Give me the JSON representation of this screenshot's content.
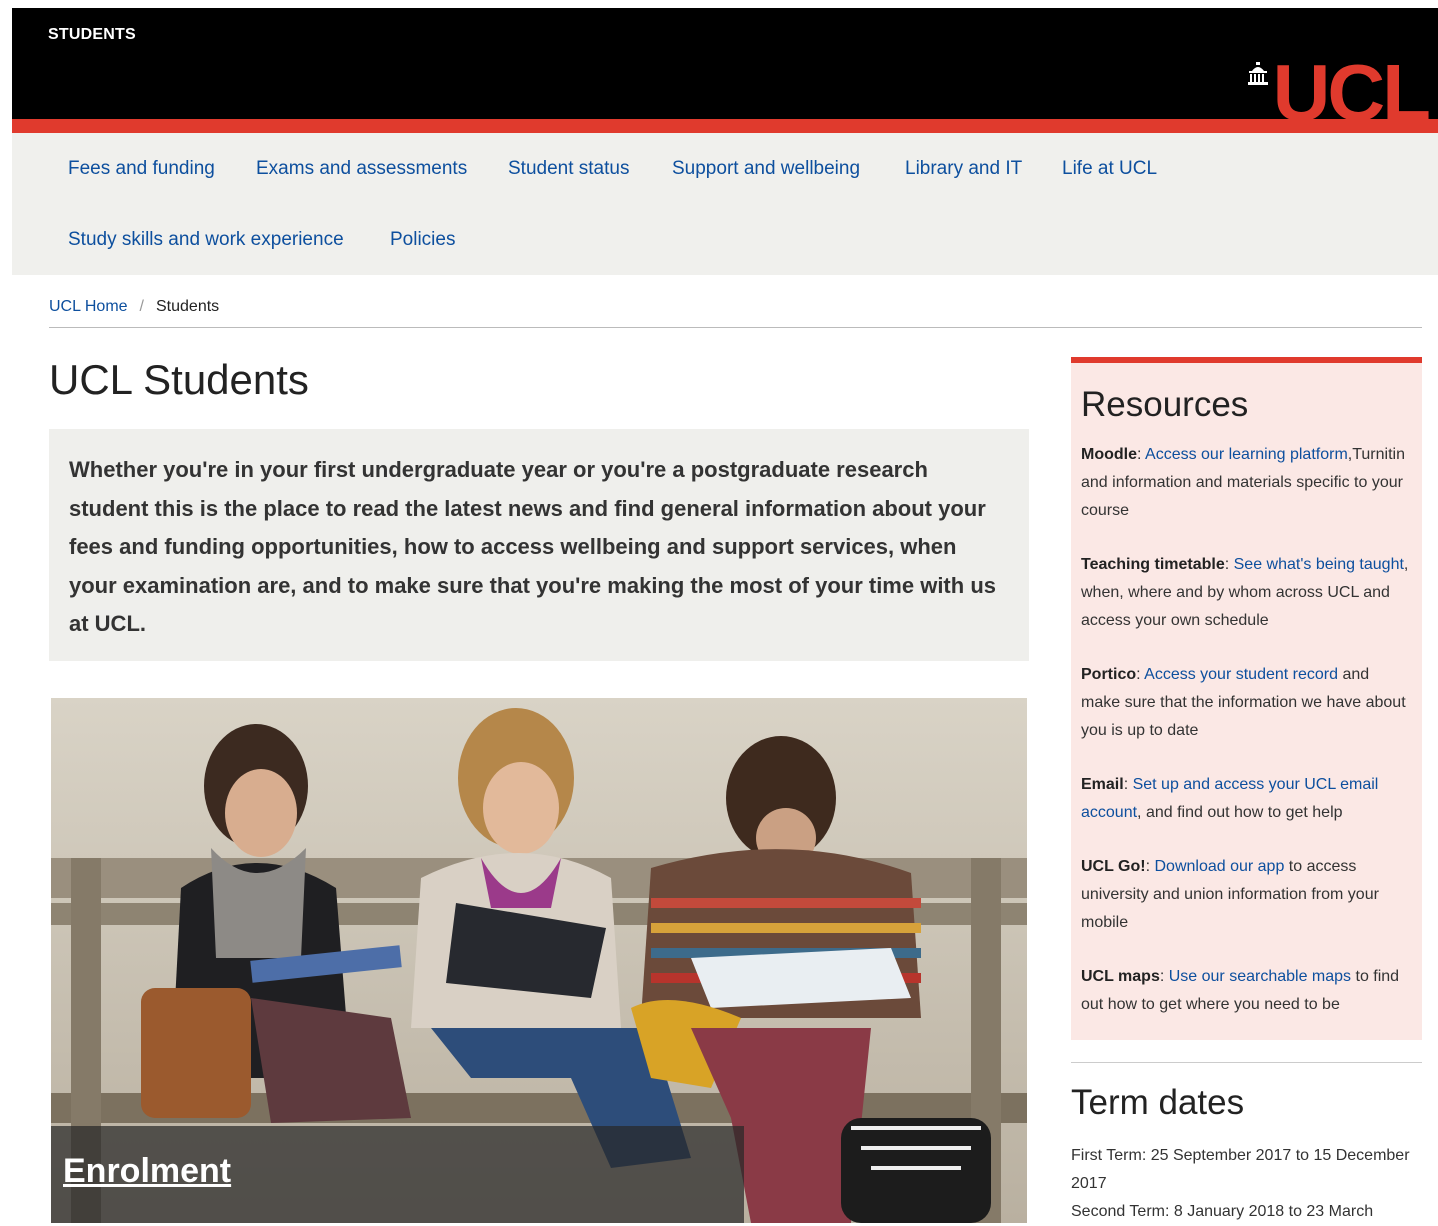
{
  "header": {
    "section_title": "STUDENTS",
    "logo_text": "UCL",
    "accent_color": "#e03a2d"
  },
  "nav": {
    "items": [
      {
        "label": "Fees and funding"
      },
      {
        "label": "Exams and assessments"
      },
      {
        "label": "Student status"
      },
      {
        "label": "Support and wellbeing"
      },
      {
        "label": "Library and IT"
      },
      {
        "label": "Life at UCL"
      },
      {
        "label": "Study skills and work experience"
      },
      {
        "label": "Policies"
      }
    ]
  },
  "breadcrumb": {
    "home": "UCL Home",
    "separator": "/",
    "current": "Students"
  },
  "main": {
    "title": "UCL Students",
    "intro": "Whether you're in your first undergraduate year or you're a postgraduate research student this is the place to read the latest news and find general information about your fees and funding opportunities, how to access wellbeing and support services, when your examination are, and to make sure that you're making the most of your time with us at UCL.",
    "hero_caption": "Enrolment"
  },
  "resources": {
    "title": "Resources",
    "items": [
      {
        "name": "Moodle",
        "sep": ": ",
        "link": "Access our learning platform",
        "text": ",Turnitin and  information and materials specific to your course"
      },
      {
        "name": "Teaching timetable",
        "sep": ": ",
        "link": "See what's being taught",
        "text": ", when, where and by whom across UCL and access your own schedule"
      },
      {
        "name": "Portico",
        "sep": ": ",
        "link": "Access your student record",
        "text": " and make sure that the information we have about you is up to date"
      },
      {
        "name": "Email",
        "sep": ": ",
        "link": "Set up and access your UCL email account",
        "text": ", and find out how to get help"
      },
      {
        "name": "UCL Go!",
        "sep": ": ",
        "link": "Download our app",
        "text": " to access university and union information from your mobile"
      },
      {
        "name": "UCL maps",
        "sep": ": ",
        "link": "Use our searchable maps",
        "text": " to find out how to get where you need to be"
      }
    ]
  },
  "term_dates": {
    "title": "Term dates",
    "first": "First Term: 25 September 2017 to 15 December 2017",
    "second": "Second Term: 8 January 2018 to 23 March"
  }
}
